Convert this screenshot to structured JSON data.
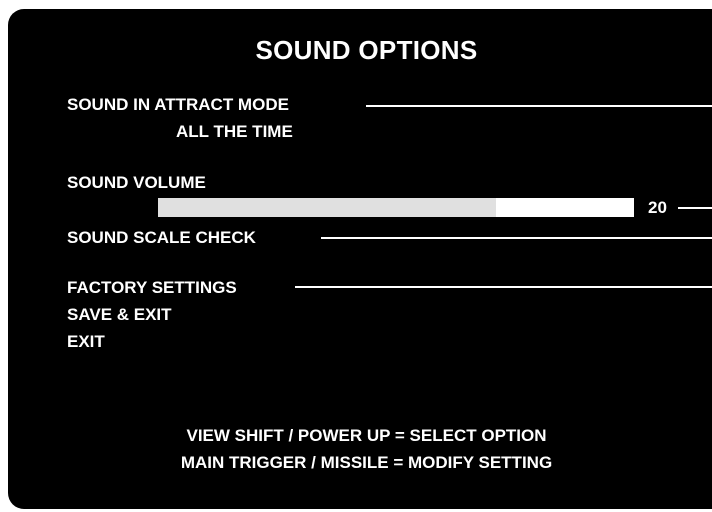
{
  "screen": {
    "title": "SOUND OPTIONS"
  },
  "options": {
    "attract_mode": {
      "label": "SOUND IN ATTRACT MODE",
      "value": "ALL THE TIME"
    },
    "volume": {
      "label": "SOUND VOLUME",
      "value": "20",
      "level_fraction": 0.71
    },
    "scale_check": {
      "label": "SOUND SCALE CHECK"
    },
    "factory_settings": {
      "label": "FACTORY SETTINGS"
    },
    "save_exit": {
      "label": "SAVE & EXIT"
    },
    "exit": {
      "label": "EXIT"
    }
  },
  "instructions": {
    "line1": "VIEW SHIFT / POWER UP = SELECT OPTION",
    "line2": "MAIN TRIGGER / MISSILE = MODIFY SETTING"
  },
  "colors": {
    "background": "#000000",
    "text": "#ffffff",
    "bar_fill": "#e0e0e0",
    "bar_track": "#ffffff"
  }
}
